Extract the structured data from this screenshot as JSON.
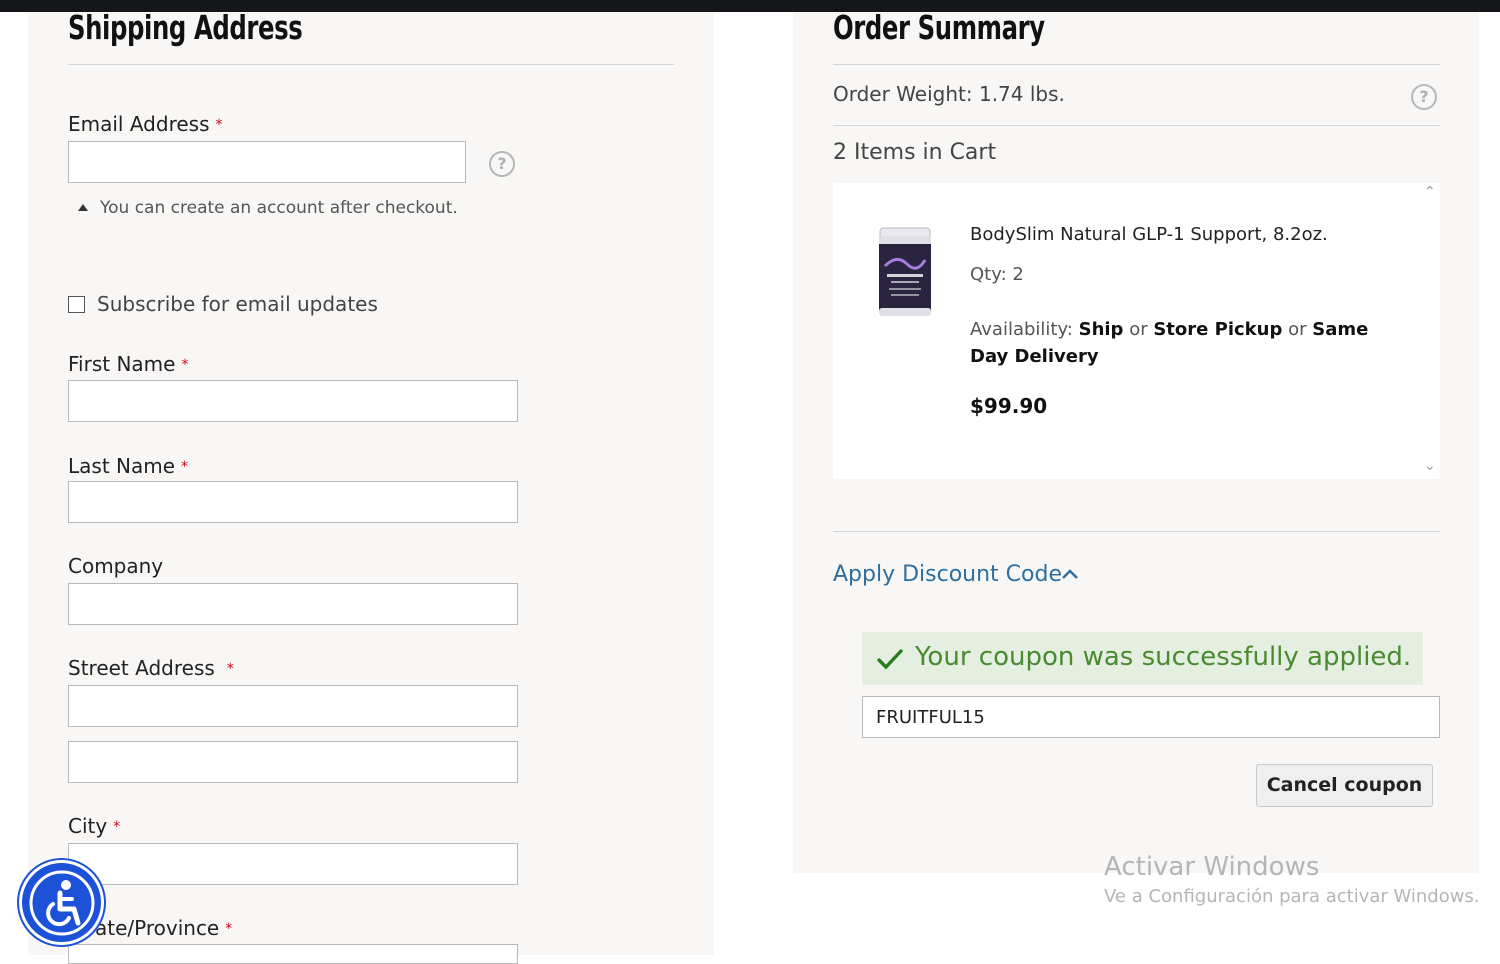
{
  "shipping": {
    "title": "Shipping Address",
    "email_label": "Email Address",
    "email_value": "",
    "required_mark": "*",
    "help_glyph": "?",
    "email_note": "You can create an account after checkout.",
    "subscribe_label": "Subscribe for email updates",
    "subscribe_checked": false,
    "first_name_label": "First Name",
    "last_name_label": "Last Name",
    "company_label": "Company",
    "street_label": "Street Address",
    "city_label": "City",
    "state_label": "ate/Province"
  },
  "summary": {
    "title": "Order Summary",
    "weight": "Order Weight: 1.74 lbs.",
    "items_count": "2 Items in Cart",
    "product": {
      "name": "BodySlim Natural GLP-1 Support, 8.2oz.",
      "qty": "Qty: 2",
      "availability_prefix": "Availability:",
      "opt1": "Ship",
      "or": "or",
      "opt2": "Store Pickup",
      "opt3": "Same Day Delivery",
      "price": "$99.90",
      "image_icon": "product-jar-icon"
    },
    "discount_label": "Apply Discount Code",
    "success_message": "Your coupon was successfully applied.",
    "coupon_value": "FRUITFUL15",
    "cancel_label": "Cancel coupon"
  },
  "watermark": {
    "line1": "Activar Windows",
    "line2": "Ve a Configuración para activar Windows."
  },
  "colors": {
    "link": "#2f6f9f",
    "success": "#4a8a31",
    "success_bg": "#e5efe1",
    "required": "#d0021b",
    "accessibility": "#1d52d8"
  }
}
